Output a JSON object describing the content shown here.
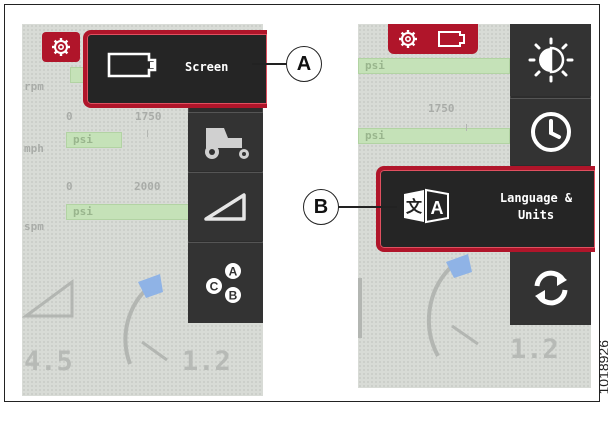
{
  "left_panel": {
    "labels": {
      "rpm": "rpm",
      "mph": "mph",
      "spm": "spm"
    },
    "scale": {
      "zero_1": "0",
      "v1750": "1750",
      "zero_2": "0",
      "v2000": "2000"
    },
    "psi": "psi",
    "bottom_values": {
      "a": "4.5",
      "b": "1.2"
    },
    "highlight_label": "Screen"
  },
  "right_panel": {
    "scale": {
      "v1750": "1750"
    },
    "psi": "psi",
    "bottom_value": "1.2",
    "highlight_label": "Language & Units"
  },
  "callouts": {
    "a": "A",
    "b": "B"
  },
  "figure_number": "1018926",
  "colors": {
    "accent_red": "#b0152a",
    "menu_dark": "#2d2d2d",
    "gauge_blue": "#8fb3e6",
    "bar_green": "#c5e2b8"
  },
  "icons": {
    "left_menu": [
      "settings-gear-icon",
      "screen-display-icon",
      "tractor-vehicle-icon",
      "incline-angle-icon",
      "abc-options-icon"
    ],
    "right_menu": [
      "settings-gear-icon",
      "screen-display-icon",
      "brightness-icon",
      "clock-icon",
      "language-translate-icon",
      "refresh-sync-icon"
    ]
  }
}
